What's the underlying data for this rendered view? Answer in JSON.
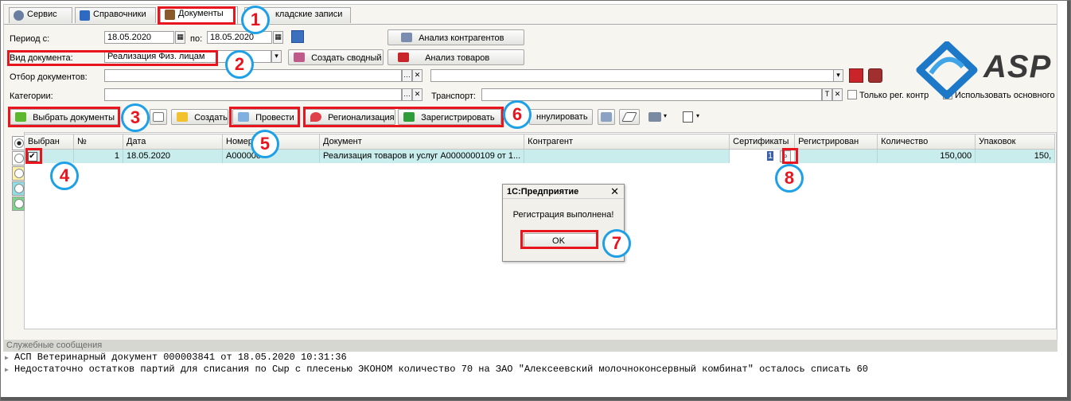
{
  "tabs": [
    {
      "label": "Сервис",
      "icon": "gear-icon",
      "color": "#6a7fa0"
    },
    {
      "label": "Справочники",
      "icon": "book-icon",
      "color": "#2f6ac2"
    },
    {
      "label": "Документы",
      "icon": "briefcase-icon",
      "color": "#8a5a2a"
    },
    {
      "label": "кладские записи",
      "icon": "",
      "color": ""
    }
  ],
  "filters": {
    "period_label": "Период с:",
    "period_from": "18.05.2020",
    "period_to_label": "по:",
    "period_to": "18.05.2020",
    "doctype_label": "Вид документа:",
    "doctype_value": "Реализация Физ. лицам",
    "docfilter_label": "Отбор документов:",
    "categories_label": "Категории:",
    "transport_label": "Транспорт:",
    "transport_t": "T",
    "only_reg_label": "Только рег. контр",
    "use_main_label": "Использовать основного"
  },
  "buttons": {
    "analysis_contractors": "Анализ контрагентов",
    "create_summary": "Создать сводный",
    "analysis_goods": "Анализ товаров",
    "select_docs": "Выбрать документы",
    "create": "Создать",
    "post": "Провести",
    "regionalize": "Регионализация",
    "register": "Зарегистрировать",
    "cancel": "ннулировать"
  },
  "table": {
    "columns": [
      "Выбран",
      "№",
      "Дата",
      "Номер",
      "Документ",
      "Контрагент",
      "Сертификаты",
      "Регистрирован",
      "Количество",
      "Упаковок"
    ],
    "row": {
      "num": "1",
      "date": "18.05.2020",
      "number": "A000000",
      "document": "Реализация товаров и услуг A0000000109 от 1...",
      "contractor": "",
      "certificates": "1",
      "registered": "",
      "quantity": "150,000",
      "packages": "150,"
    }
  },
  "dialog": {
    "title": "1С:Предприятие",
    "message": "Регистрация выполнена!",
    "ok": "OK"
  },
  "messages": {
    "header": "Служебные сообщения",
    "lines": [
      "АСП Ветеринарный документ 000003841 от 18.05.2020 10:31:36",
      "Недостаточно остатков партий для списания по Сыр с плесенью ЭКОНОМ количество 70 на ЗАО \"Алексеевский молочноконсервный комбинат\" осталось списать 60"
    ]
  },
  "badges": [
    "1",
    "2",
    "3",
    "4",
    "5",
    "6",
    "7",
    "8"
  ],
  "logo_text": "ASP",
  "colors": {
    "annotation_red": "#e8151e",
    "badge_blue": "#1ea0e6",
    "selected_row": "#c9ecec"
  }
}
